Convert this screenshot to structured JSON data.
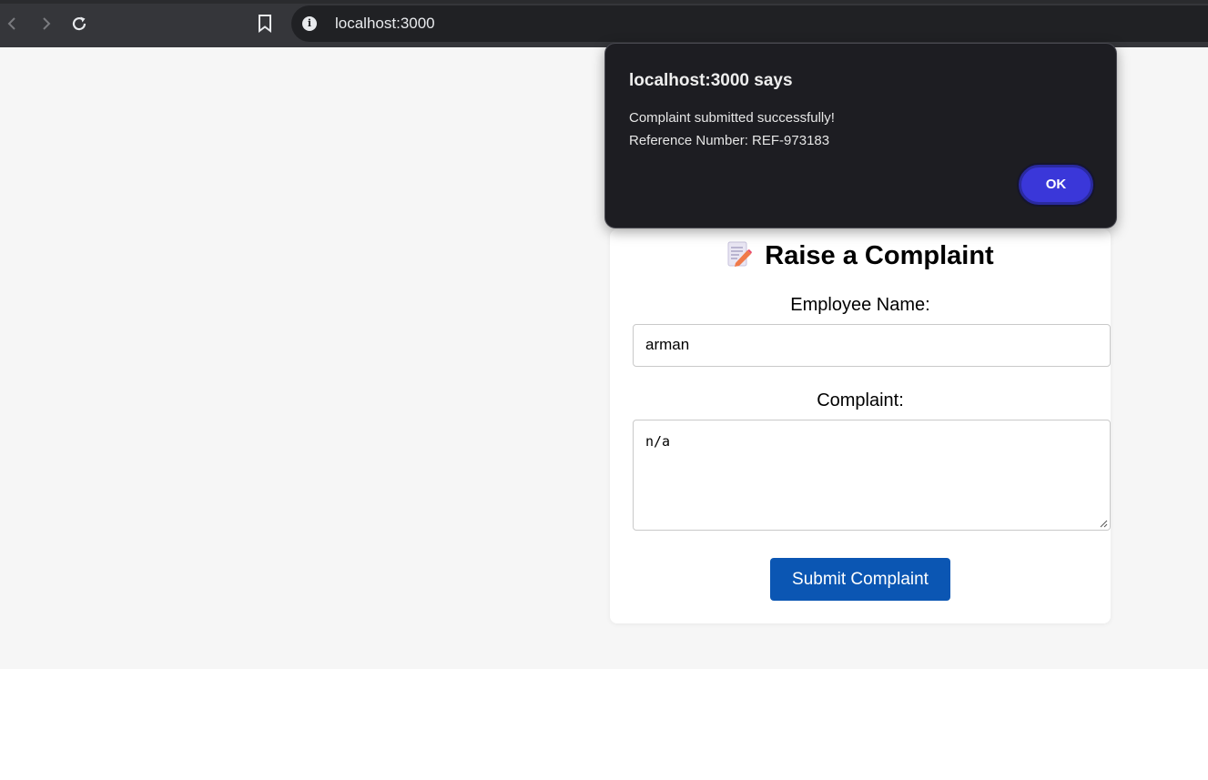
{
  "browser": {
    "url": "localhost:3000",
    "icons": [
      "back-icon",
      "forward-icon",
      "reload-icon",
      "bookmark-icon",
      "info-icon"
    ]
  },
  "dialog": {
    "title": "localhost:3000 says",
    "message_line1": "Complaint submitted successfully!",
    "message_line2": "Reference Number: REF-973183",
    "ok_label": "OK"
  },
  "form": {
    "title": "Raise a Complaint",
    "title_icon": "memo-icon",
    "employee_name_label": "Employee Name:",
    "employee_name_value": "arman",
    "complaint_label": "Complaint:",
    "complaint_value": "n/a",
    "submit_label": "Submit Complaint"
  },
  "colors": {
    "submit_button": "#0b56b3",
    "ok_button": "#3a37d9",
    "dialog_bg": "#1d1d22",
    "page_bg": "#f6f6f6"
  }
}
